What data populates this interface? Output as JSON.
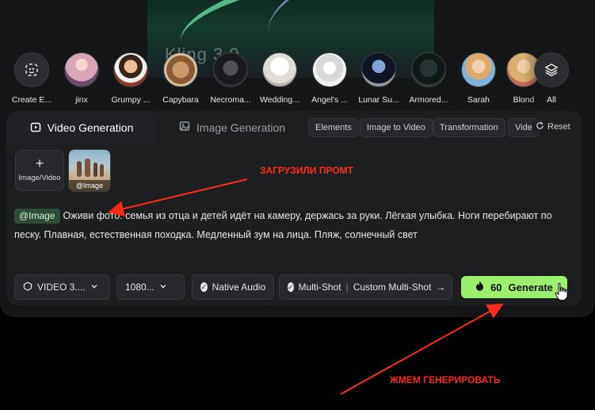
{
  "hero": {
    "logo_text": "Kling 3.0"
  },
  "presets": [
    {
      "label": "Create E...",
      "icon": "sparkle-face-icon"
    },
    {
      "label": "jinx",
      "color": "#d9a6b8"
    },
    {
      "label": "Grumpy ...",
      "color": "#c4885a"
    },
    {
      "label": "Capybara",
      "color": "#b07a4a"
    },
    {
      "label": "Necroma...",
      "color": "#3a3a3e"
    },
    {
      "label": "Wedding...",
      "color": "#e9e6e0"
    },
    {
      "label": "Angel's ...",
      "color": "#dcdcdc"
    },
    {
      "label": "Lunar Su...",
      "color": "#3a4a66"
    },
    {
      "label": "Armored...",
      "color": "#1f2a2a"
    },
    {
      "label": "Sarah",
      "color": "#e7b98f"
    },
    {
      "label": "Blond",
      "color": "#d8b070"
    },
    {
      "label": "All",
      "icon": "layers-icon"
    }
  ],
  "tabs": {
    "video": "Video Generation",
    "image": "Image Generation"
  },
  "chips": [
    "Elements",
    "Image to Video",
    "Transformation",
    "Video"
  ],
  "reset_label": "Reset",
  "upload": {
    "label": "Image/Video",
    "plus": "+"
  },
  "thumb_caption": "@Image",
  "prompt": {
    "tag": "@Image",
    "text": "Оживи фото: семья из отца и детей идёт на камеру, держась за руки. Лёгкая улыбка. Ноги перебирают по песку. Плавная, естественная походка. Медленный зум на лица. Пляж, солнечный свет"
  },
  "toolbar": {
    "model": "VIDEO 3....",
    "resolution": "1080...",
    "native_audio": "Native Audio",
    "multi_shot": "Multi-Shot",
    "custom_multi_shot": "Custom Multi-Shot",
    "arrow": "→"
  },
  "generate": {
    "credits": "60",
    "label": "Generate"
  },
  "annotations": {
    "upload_note": "ЗАГРУЗИЛИ ПРОМТ",
    "generate_note": "ЖМЕМ ГЕНЕРИРОВАТЬ",
    "color": "#ff2a1a"
  }
}
